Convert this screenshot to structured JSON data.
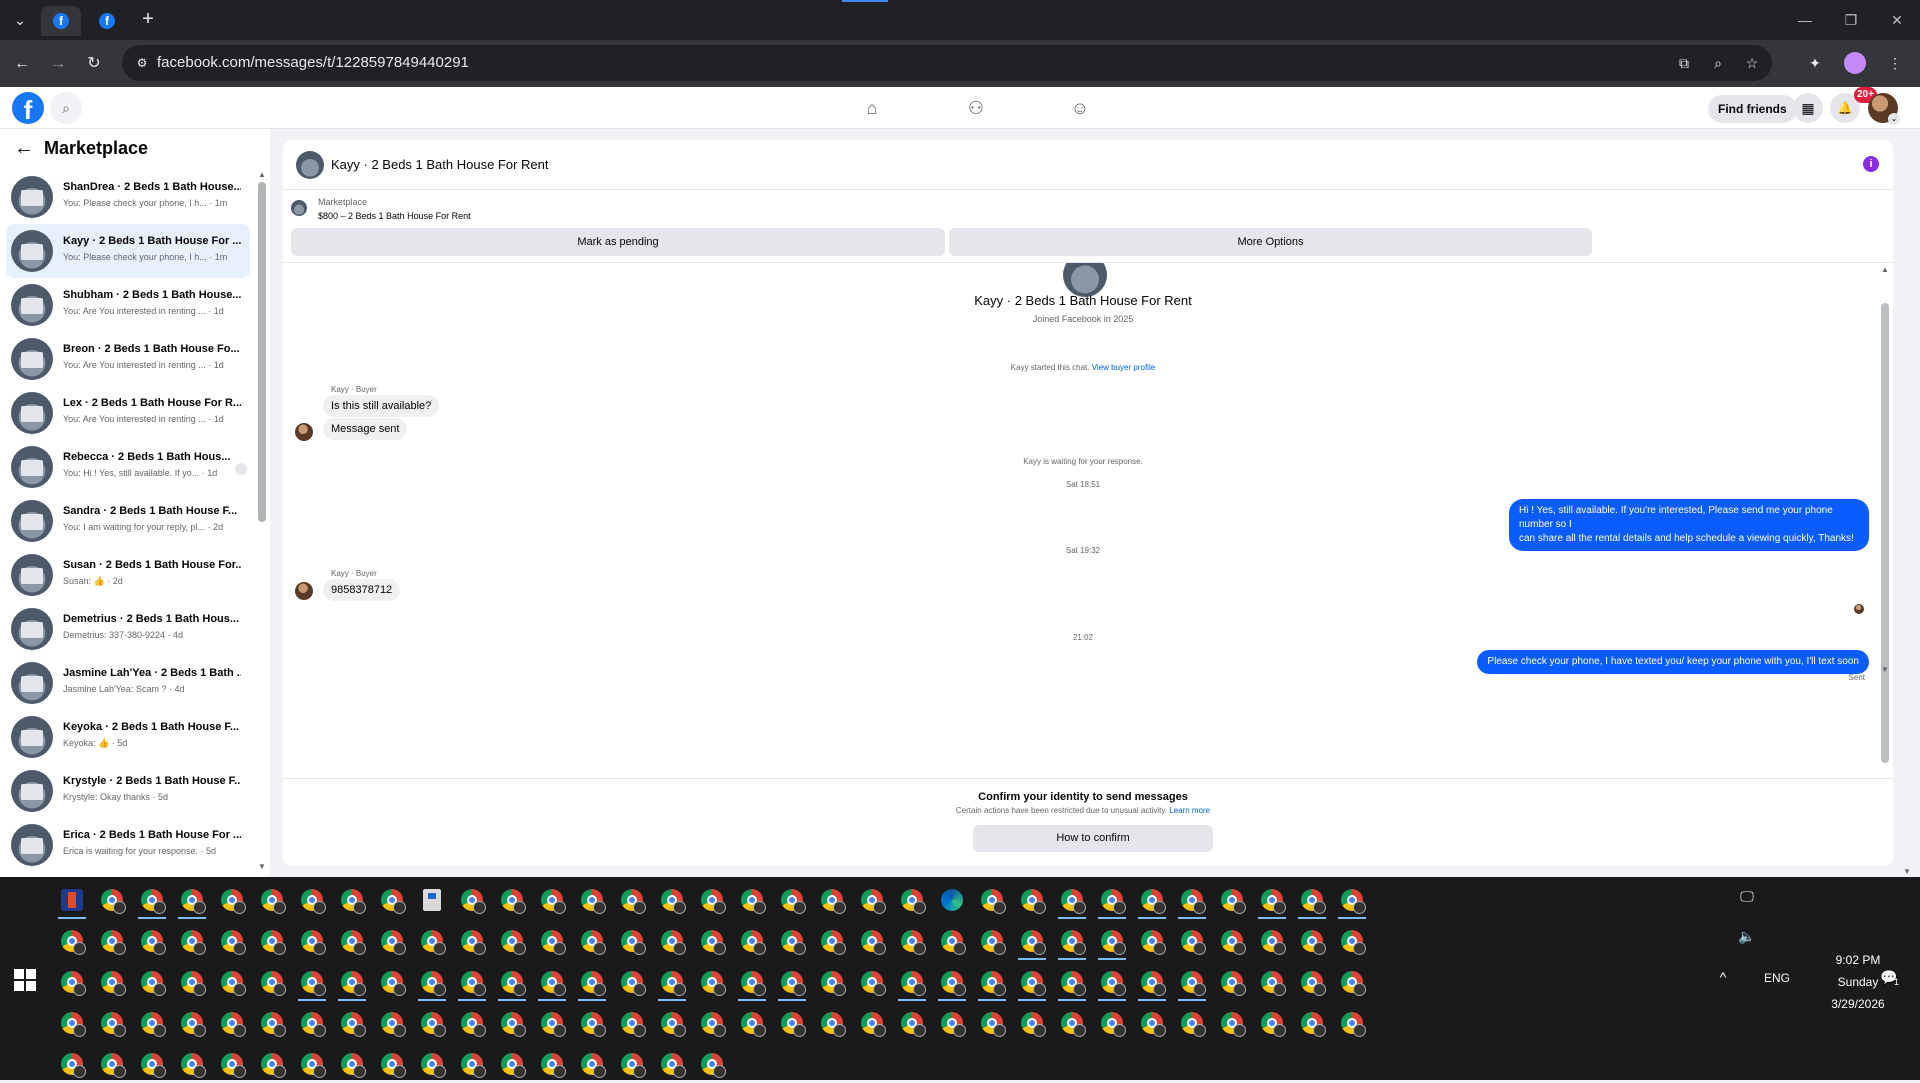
{
  "browser": {
    "dropdown_icon": "chevron-down-icon",
    "tab_icon": "f",
    "new_tab": "+",
    "win_minimize": "—",
    "win_restore": "❐",
    "win_close": "✕",
    "back": "←",
    "forward": "→",
    "reload": "↻",
    "site_info": "⚙",
    "url": "facebook.com/messages/t/1228597849440291",
    "omni_actions": [
      "⧉",
      "⌕",
      "☆"
    ],
    "ext_icons": [
      "✦",
      "●",
      "⋮"
    ]
  },
  "fb": {
    "logo": "f",
    "search_icon": "⌕",
    "nav": [
      "⌂",
      "⚇",
      "☺"
    ],
    "find_friends": "Find friends",
    "menu_icon": "▦",
    "bell_icon": "🔔",
    "notif_count": "20+",
    "account_chevron": "⌄"
  },
  "sidebar": {
    "back_icon": "←",
    "title": "Marketplace",
    "conversations": [
      {
        "name": "ShanDrea · 2 Beds 1 Bath House...",
        "snippet": "You: Please check your phone, I h... · 1m",
        "selected": false
      },
      {
        "name": "Kayy · 2 Beds 1 Bath House For ...",
        "snippet": "You: Please check your phone, I h... · 1m",
        "selected": true
      },
      {
        "name": "Shubham · 2 Beds 1 Bath House...",
        "snippet": "You: Are You interested in renting ... · 1d",
        "selected": false
      },
      {
        "name": "Breon · 2 Beds 1 Bath House Fo...",
        "snippet": "You: Are You interested in renting ... · 1d",
        "selected": false
      },
      {
        "name": "Lex · 2 Beds 1 Bath House For R...",
        "snippet": "You: Are You interested in renting ... · 1d",
        "selected": false
      },
      {
        "name": "Rebecca · 2 Beds 1 Bath Hous...",
        "snippet": "You: Hi ! Yes, still available. If yo... · 1d",
        "selected": false
      },
      {
        "name": "Sandra · 2 Beds 1 Bath House F...",
        "snippet": "You: I am waiting for your reply, pl... · 2d",
        "selected": false
      },
      {
        "name": "Susan · 2 Beds 1 Bath House For...",
        "snippet": "Susan: 👍 · 2d",
        "selected": false
      },
      {
        "name": "Demetrius · 2 Beds 1 Bath Hous...",
        "snippet": "Demetrius: 337-380-9224 · 4d",
        "selected": false
      },
      {
        "name": "Jasmine Lah'Yea · 2 Beds 1 Bath ...",
        "snippet": "Jasmine Lah'Yea: Scam ? · 4d",
        "selected": false
      },
      {
        "name": "Keyoka · 2 Beds 1 Bath House F...",
        "snippet": "Keyoka: 👍 · 5d",
        "selected": false
      },
      {
        "name": "Krystyle · 2 Beds 1 Bath House F...",
        "snippet": "Krystyle: Okay thanks · 5d",
        "selected": false
      },
      {
        "name": "Erica · 2 Beds 1 Bath House For ...",
        "snippet": "Erica is waiting for your response. · 5d",
        "selected": false
      }
    ],
    "scroll_up": "▲",
    "scroll_down": "▼"
  },
  "chat": {
    "title": "Kayy · 2 Beds 1 Bath House For Rent",
    "info_icon": "i",
    "marketplace_label": "Marketplace",
    "listing": "$800 – 2 Beds 1 Bath House For Rent",
    "mark_pending": "Mark as pending",
    "more_options": "More Options",
    "profile_name": "Kayy · 2 Beds 1 Bath House For Rent",
    "joined": "Joined Facebook in 2025",
    "started_prefix": "Kayy started this chat.",
    "view_buyer": "View buyer profile",
    "sender1": "Kayy · Buyer",
    "msg1": "Is this still available?",
    "msg2": "Message sent",
    "waiting": "Kayy is waiting for your response.",
    "time1": "Sat 18:51",
    "out1_line1": "Hi ! Yes, still available. If you're interested, Please send me your phone number so I",
    "out1_line2": "can share all the rental details and help schedule a viewing quickly, Thanks!",
    "time2": "Sat 19:32",
    "sender2": "Kayy · Buyer",
    "msg3": "9858378712",
    "time3": "21:02",
    "out2": "Please check your phone, I have texted you/ keep your phone with you, I'll text soon",
    "sent": "Sent",
    "scroll_up": "▲",
    "scroll_down": "▼",
    "confirm_title": "Confirm your identity to send messages",
    "confirm_desc": "Certain actions have been restricted due to unusual activity.",
    "learn_more": "Learn more",
    "how_confirm": "How to confirm"
  },
  "taskbar": {
    "tray_chevron": "^",
    "language": "ENG",
    "network_icon": "🖵",
    "volume_icon": "🔈",
    "time": "9:02 PM",
    "day": "Sunday",
    "date": "3/29/2026",
    "notif_icon": "💬",
    "notif_count": "1"
  }
}
